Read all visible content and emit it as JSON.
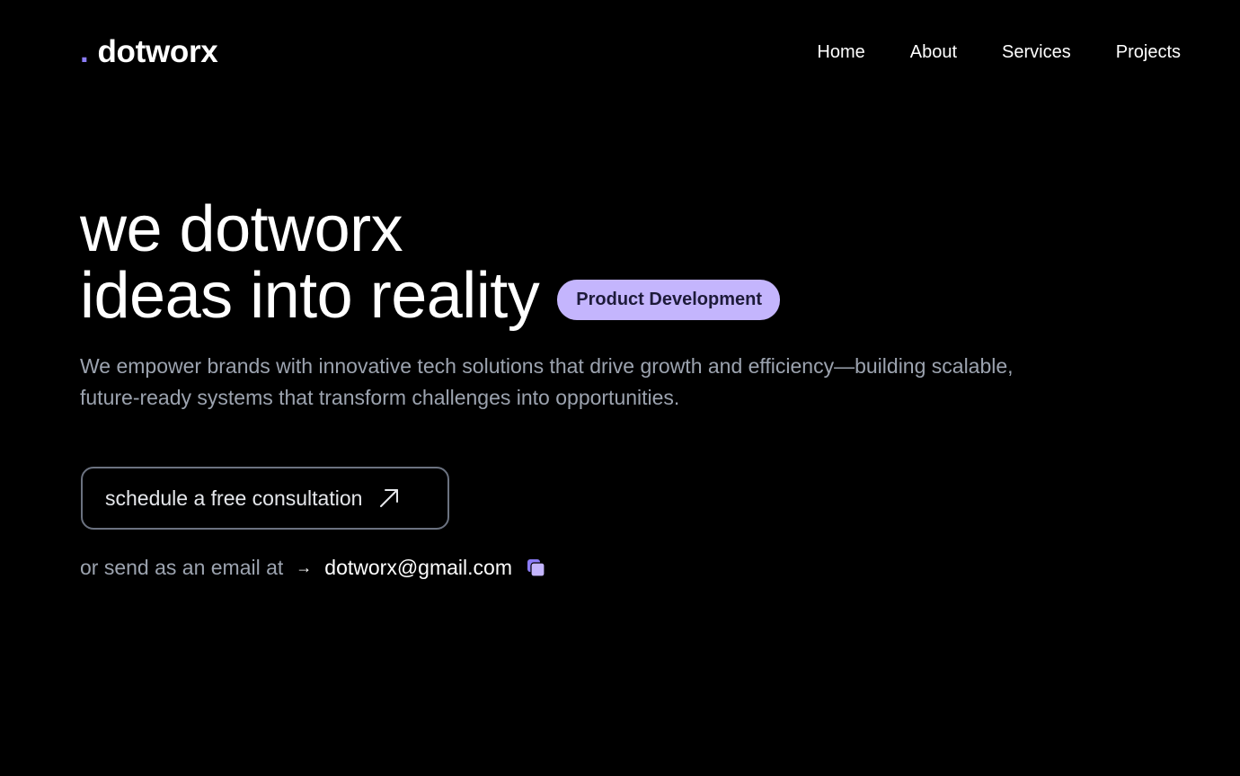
{
  "header": {
    "logo_dot": ".",
    "logo_text": "dotworx",
    "nav": [
      {
        "label": "Home"
      },
      {
        "label": "About"
      },
      {
        "label": "Services"
      },
      {
        "label": "Projects"
      }
    ]
  },
  "hero": {
    "headline_line1": "we dotworx",
    "headline_line2": "ideas into reality",
    "badge": "Product Development",
    "subtitle": "We empower brands with innovative tech solutions that drive growth and efficiency—building scalable, future-ready systems that transform challenges into opportunities.",
    "cta_label": "schedule a free consultation",
    "cta_icon": "arrow-up-right-icon",
    "email_prefix": "or send as an email at",
    "email_arrow": "→",
    "email": "dotworx@gmail.com",
    "copy_icon": "copy-icon"
  },
  "colors": {
    "background": "#000000",
    "accent": "#8b7cf6",
    "badge_bg": "#c4b5fd",
    "muted_text": "#9ca3af",
    "border": "#6b7280"
  }
}
